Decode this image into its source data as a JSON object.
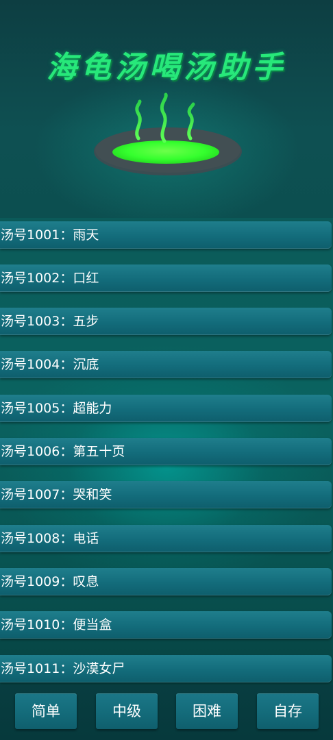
{
  "header": {
    "title": "海龟汤喝汤助手",
    "icon": "soup-pot-icon",
    "colors": {
      "title": "#27e87a",
      "soup": "#35ff2e",
      "steam": "#37e84a"
    }
  },
  "soups": [
    {
      "prefix": "汤号1001：",
      "name": "雨天"
    },
    {
      "prefix": "汤号1002：",
      "name": "口红"
    },
    {
      "prefix": "汤号1003：",
      "name": "五步"
    },
    {
      "prefix": "汤号1004：",
      "name": "沉底"
    },
    {
      "prefix": "汤号1005：",
      "name": "超能力"
    },
    {
      "prefix": "汤号1006：",
      "name": "第五十页"
    },
    {
      "prefix": "汤号1007：",
      "name": "哭和笑"
    },
    {
      "prefix": "汤号1008：",
      "name": "电话"
    },
    {
      "prefix": "汤号1009：",
      "name": "叹息"
    },
    {
      "prefix": "汤号1010：",
      "name": "便当盒"
    },
    {
      "prefix": "汤号1011：",
      "name": "沙漠女尸"
    }
  ],
  "footer": {
    "buttons": [
      {
        "label": "简单"
      },
      {
        "label": "中级"
      },
      {
        "label": "困难"
      },
      {
        "label": "自存"
      }
    ]
  },
  "colors": {
    "background": "#0a6360",
    "row": "#136c7b",
    "button": "#136a79"
  }
}
